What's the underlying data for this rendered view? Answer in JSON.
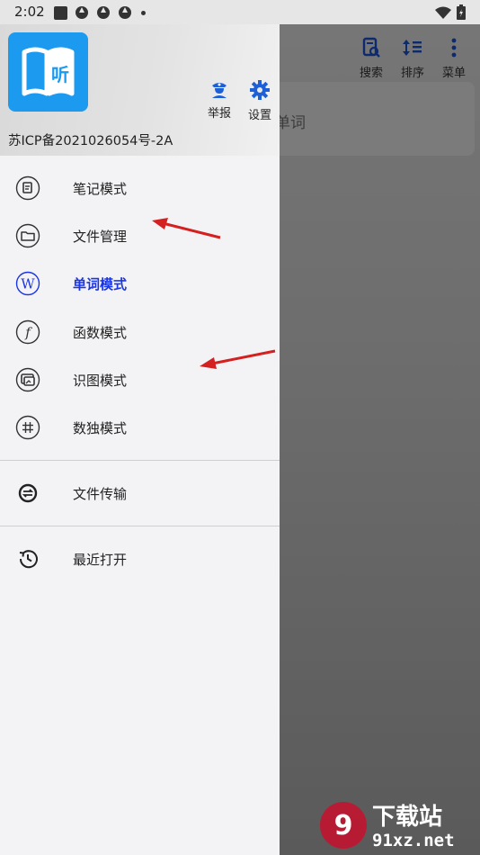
{
  "status_bar": {
    "time": "2:02"
  },
  "toolbar": {
    "search_label": "搜索",
    "sort_label": "排序",
    "menu_label": "菜单"
  },
  "background": {
    "card_text": "单词"
  },
  "drawer": {
    "logo_text": "听",
    "report_label": "举报",
    "settings_label": "设置",
    "icp": "苏ICP备2021026054号-2A",
    "items": [
      {
        "label": "笔记模式",
        "icon": "note-icon",
        "active": false
      },
      {
        "label": "文件管理",
        "icon": "folder-icon",
        "active": false
      },
      {
        "label": "单词模式",
        "icon": "word-w-icon",
        "active": true
      },
      {
        "label": "函数模式",
        "icon": "function-icon",
        "active": false
      },
      {
        "label": "识图模式",
        "icon": "image-recognize-icon",
        "active": false
      },
      {
        "label": "数独模式",
        "icon": "sudoku-hash-icon",
        "active": false
      },
      {
        "label": "文件传输",
        "icon": "transfer-icon",
        "active": false
      },
      {
        "label": "最近打开",
        "icon": "history-icon",
        "active": false
      }
    ]
  },
  "colors": {
    "accent": "#1a35e6",
    "logo": "#1c9af0",
    "arrow": "#d42020"
  },
  "watermark": {
    "main": "下载站",
    "sub": "91xz.net"
  }
}
